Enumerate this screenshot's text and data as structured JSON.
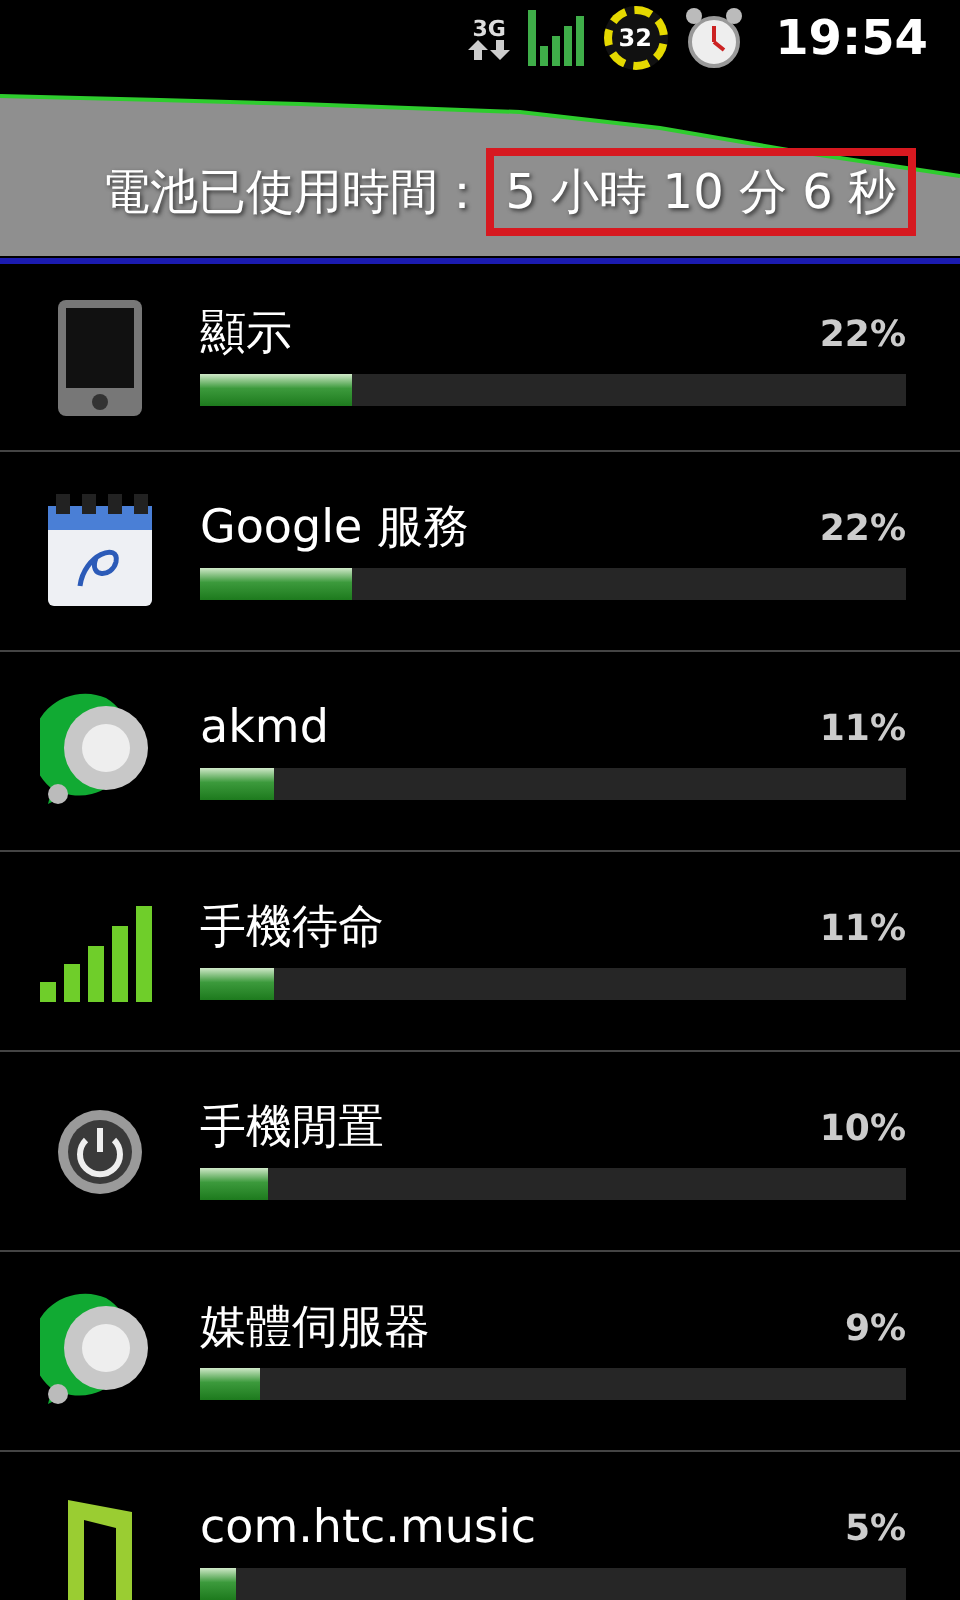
{
  "status_bar": {
    "network": "3G",
    "battery": "32",
    "time": "19:54"
  },
  "header": {
    "label": "電池已使用時間：",
    "duration": "5 小時 10 分 6 秒",
    "highlighted": true
  },
  "items": [
    {
      "name": "顯示",
      "percent": "22%",
      "level": 0.215,
      "kind": "phone"
    },
    {
      "name": "Google 服務",
      "percent": "22%",
      "level": 0.215,
      "kind": "calendar"
    },
    {
      "name": "akmd",
      "percent": "11%",
      "level": 0.105,
      "kind": "knob"
    },
    {
      "name": "手機待命",
      "percent": "11%",
      "level": 0.105,
      "kind": "signal"
    },
    {
      "name": "手機閒置",
      "percent": "10%",
      "level": 0.096,
      "kind": "power"
    },
    {
      "name": "媒體伺服器",
      "percent": "9%",
      "level": 0.085,
      "kind": "knob"
    },
    {
      "name": "com.htc.music",
      "percent": "5%",
      "level": 0.05,
      "kind": "music"
    }
  ]
}
